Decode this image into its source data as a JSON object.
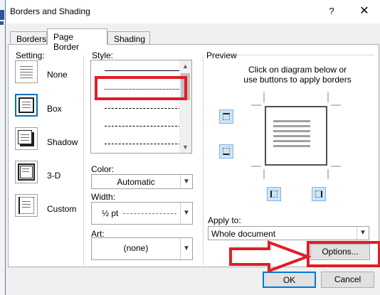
{
  "window": {
    "title": "Borders and Shading",
    "help": "?",
    "close": "✕"
  },
  "tabs": [
    {
      "label": "Borders",
      "active": false
    },
    {
      "label": "Page Border",
      "active": true
    },
    {
      "label": "Shading",
      "active": false
    }
  ],
  "setting": {
    "label": "Setting:",
    "items": [
      {
        "label": "None",
        "selected": false
      },
      {
        "label": "Box",
        "selected": true
      },
      {
        "label": "Shadow",
        "selected": false
      },
      {
        "label": "3-D",
        "selected": false
      },
      {
        "label": "Custom",
        "selected": false
      }
    ]
  },
  "style": {
    "label": "Style:",
    "selected_index": 1
  },
  "color": {
    "label": "Color:",
    "value": "Automatic"
  },
  "width": {
    "label": "Width:",
    "value": "½ pt"
  },
  "art": {
    "label": "Art:",
    "value": "(none)"
  },
  "preview": {
    "label": "Preview",
    "instruction_line1": "Click on diagram below or",
    "instruction_line2": "use buttons to apply borders"
  },
  "apply_to": {
    "label": "Apply to:",
    "value": "Whole document"
  },
  "buttons": {
    "options": "Options...",
    "ok": "OK",
    "cancel": "Cancel"
  },
  "colors": {
    "annotation": "#e11d26",
    "accent": "#0078d7"
  }
}
